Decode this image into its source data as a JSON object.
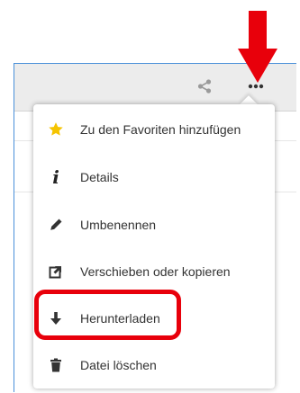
{
  "menu": {
    "items": [
      {
        "icon": "star-icon",
        "label": "Zu den Favoriten hinzufügen"
      },
      {
        "icon": "info-icon",
        "label": "Details"
      },
      {
        "icon": "pencil-icon",
        "label": "Umbenennen"
      },
      {
        "icon": "move-copy-icon",
        "label": "Verschieben oder kopieren"
      },
      {
        "icon": "download-icon",
        "label": "Herunterladen"
      },
      {
        "icon": "trash-icon",
        "label": "Datei löschen"
      }
    ],
    "highlighted_item": "Herunterladen"
  },
  "toolbar": {
    "icons": [
      "share-icon",
      "more-icon"
    ]
  },
  "colors": {
    "annotation": "#e8000b",
    "star": "#f5c400",
    "frame": "#4a90d9",
    "toolbar": "#ececec"
  },
  "info_glyph": "i"
}
